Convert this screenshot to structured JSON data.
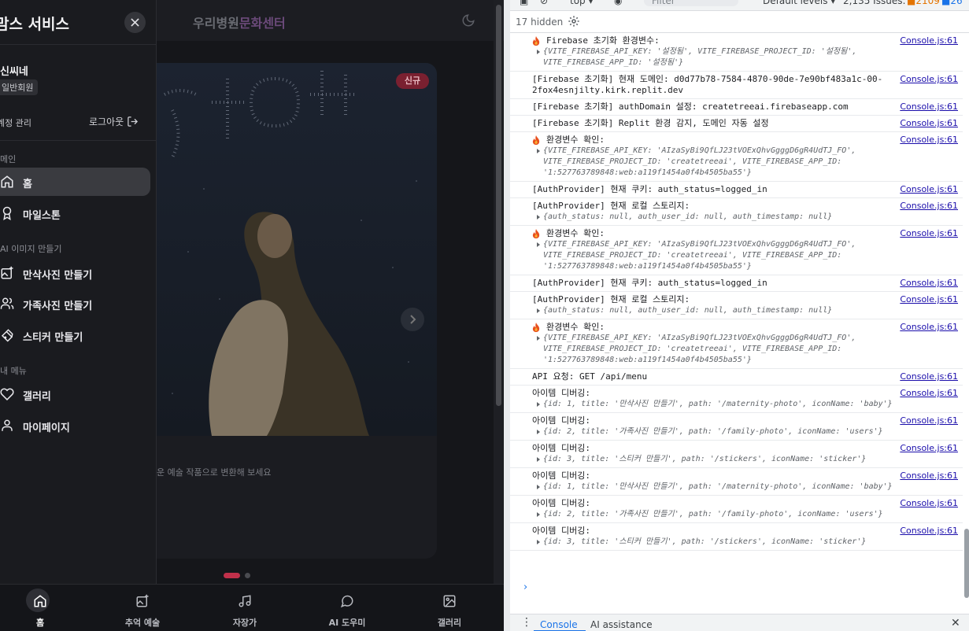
{
  "app": {
    "header_title_main": "우리병원",
    "header_title_accent": "문화센터",
    "badge_new": "신규",
    "hero_caption": "운 예술 작품으로 변환해 보세요"
  },
  "drawer": {
    "title": "맘스 서비스",
    "user_name": "신씨네",
    "user_tier": "일반회원",
    "account_label": "계정 관리",
    "logout_label": "로그아웃",
    "sections": [
      {
        "label": "메인",
        "items": [
          {
            "label": "홈",
            "icon": "home-icon"
          },
          {
            "label": "마일스톤",
            "icon": "award-icon"
          }
        ]
      },
      {
        "label": "AI 이미지 만들기",
        "items": [
          {
            "label": "만삭사진 만들기",
            "icon": "image-plus-icon"
          },
          {
            "label": "가족사진 만들기",
            "icon": "users-icon"
          },
          {
            "label": "스티커 만들기",
            "icon": "sticker-icon"
          }
        ]
      },
      {
        "label": "내 메뉴",
        "items": [
          {
            "label": "갤러리",
            "icon": "heart-icon"
          },
          {
            "label": "마이페이지",
            "icon": "user-icon"
          }
        ]
      }
    ]
  },
  "bottom_nav": [
    {
      "label": "홈",
      "icon": "home-icon",
      "active": true
    },
    {
      "label": "추억 예술",
      "icon": "image-sparkle-icon"
    },
    {
      "label": "자장가",
      "icon": "music-icon"
    },
    {
      "label": "AI 도우미",
      "icon": "chat-icon"
    },
    {
      "label": "갤러리",
      "icon": "gallery-icon"
    }
  ],
  "devtools": {
    "context": "top ▾",
    "filter_placeholder": "Filter",
    "levels": "Default levels ▾",
    "issues": "2,135 Issues:",
    "issue_warn": "2109",
    "issue_info": "26",
    "hidden": "17 hidden",
    "tab_console": "Console",
    "tab_ai": "AI assistance",
    "messages": [
      {
        "fire": true,
        "text": "Firebase 초기화 환경변수:",
        "src": "Console.js:61",
        "obj": "{VITE_FIREBASE_API_KEY: '설정됨', VITE_FIREBASE_PROJECT_ID: '설정됨', VITE_FIREBASE_APP_ID: '설정됨'}"
      },
      {
        "fire": false,
        "text": "[Firebase 초기화] 현재 도메인: d0d77b78-7584-4870-90de-7e90bf483a1c-00-2fox4esnjilty.kirk.replit.dev",
        "src": "Console.js:61"
      },
      {
        "fire": false,
        "text": "[Firebase 초기화] authDomain 설정: createtreeai.firebaseapp.com",
        "src": "Console.js:61"
      },
      {
        "fire": false,
        "text": "[Firebase 초기화] Replit 환경 감지, 도메인 자동 설정",
        "src": "Console.js:61"
      },
      {
        "fire": true,
        "text": "환경변수 확인:",
        "src": "Console.js:61",
        "obj": "{VITE_FIREBASE_API_KEY: 'AIzaSyBi9QfLJ23tVOExQhvGgggD6gR4UdTJ_FO', VITE_FIREBASE_PROJECT_ID: 'createtreeai', VITE_FIREBASE_APP_ID: '1:527763789848:web:a119f1454a0f4b4505ba55'}"
      },
      {
        "fire": false,
        "text": "[AuthProvider] 현재 쿠키: auth_status=logged_in",
        "src": "Console.js:61"
      },
      {
        "fire": false,
        "text": "[AuthProvider] 현재 로컬 스토리지:",
        "src": "Console.js:61",
        "obj": "{auth_status: null, auth_user_id: null, auth_timestamp: null}"
      },
      {
        "fire": true,
        "text": "환경변수 확인:",
        "src": "Console.js:61",
        "obj": "{VITE_FIREBASE_API_KEY: 'AIzaSyBi9QfLJ23tVOExQhvGgggD6gR4UdTJ_FO', VITE_FIREBASE_PROJECT_ID: 'createtreeai', VITE_FIREBASE_APP_ID: '1:527763789848:web:a119f1454a0f4b4505ba55'}"
      },
      {
        "fire": false,
        "text": "[AuthProvider] 현재 쿠키: auth_status=logged_in",
        "src": "Console.js:61"
      },
      {
        "fire": false,
        "text": "[AuthProvider] 현재 로컬 스토리지:",
        "src": "Console.js:61",
        "obj": "{auth_status: null, auth_user_id: null, auth_timestamp: null}"
      },
      {
        "fire": true,
        "text": "환경변수 확인:",
        "src": "Console.js:61",
        "obj": "{VITE_FIREBASE_API_KEY: 'AIzaSyBi9QfLJ23tVOExQhvGgggD6gR4UdTJ_FO', VITE_FIREBASE_PROJECT_ID: 'createtreeai', VITE_FIREBASE_APP_ID: '1:527763789848:web:a119f1454a0f4b4505ba55'}"
      },
      {
        "fire": false,
        "text": "API 요청: GET /api/menu",
        "src": "Console.js:61"
      },
      {
        "fire": false,
        "text": "아이템 디버깅:",
        "src": "Console.js:61",
        "obj": "{id: 1, title: '만삭사진 만들기', path: '/maternity-photo', iconName: 'baby'}"
      },
      {
        "fire": false,
        "text": "아이템 디버깅:",
        "src": "Console.js:61",
        "obj": "{id: 2, title: '가족사진 만들기', path: '/family-photo', iconName: 'users'}"
      },
      {
        "fire": false,
        "text": "아이템 디버깅:",
        "src": "Console.js:61",
        "obj": "{id: 3, title: '스티커 만들기', path: '/stickers', iconName: 'sticker'}"
      },
      {
        "fire": false,
        "text": "아이템 디버깅:",
        "src": "Console.js:61",
        "obj": "{id: 1, title: '만삭사진 만들기', path: '/maternity-photo', iconName: 'baby'}"
      },
      {
        "fire": false,
        "text": "아이템 디버깅:",
        "src": "Console.js:61",
        "obj": "{id: 2, title: '가족사진 만들기', path: '/family-photo', iconName: 'users'}"
      },
      {
        "fire": false,
        "text": "아이템 디버깅:",
        "src": "Console.js:61",
        "obj": "{id: 3, title: '스티커 만들기', path: '/stickers', iconName: 'sticker'}"
      }
    ],
    "prompt": "›"
  },
  "colors": {
    "accent_brand": "#6b4a7a",
    "badge_bg": "#7a2030",
    "dot_active": "#c0304a",
    "link": "#1a0dab",
    "console_blue": "#1a73e8"
  }
}
